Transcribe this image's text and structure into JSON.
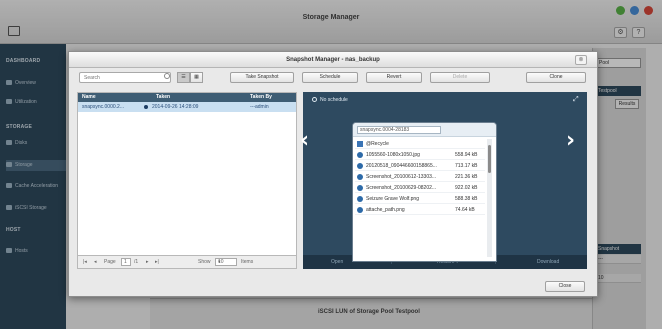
{
  "app": {
    "title": "Storage Manager"
  },
  "sidebar": {
    "sections": [
      {
        "label": "DASHBOARD"
      },
      {
        "label": "STORAGE"
      },
      {
        "label": "HOST"
      }
    ],
    "items": [
      {
        "label": "Overview",
        "icon": "overview-icon"
      },
      {
        "label": "Utilization",
        "icon": "chart-icon"
      },
      {
        "label": "Disks",
        "icon": "disk-icon"
      },
      {
        "label": "Storage",
        "icon": "storage-icon"
      },
      {
        "label": "Cache Acceleration",
        "icon": "cache-icon"
      },
      {
        "label": "iSCSI Storage",
        "icon": "iscsi-icon"
      },
      {
        "label": "Hosts",
        "icon": "hosts-icon"
      }
    ]
  },
  "background": {
    "bottom_text": "iSCSI LUN of Storage Pool Testpool"
  },
  "modal": {
    "title": "Snapshot Manager - nas_backup",
    "search_placeholder": "Search",
    "view_list": "☰",
    "view_grid": "▦",
    "buttons": {
      "take_snapshot": "Take Snapshot",
      "schedule": "Schedule",
      "revert": "Revert",
      "delete": "Delete",
      "clone": "Clone",
      "close": "Close"
    },
    "list": {
      "columns": [
        "Name",
        "Taken",
        "Taken By"
      ],
      "rows": [
        {
          "name": "snapsync.0000.2...",
          "taken": "2014-09-26 14:28:09",
          "taken_by": "---admin"
        }
      ]
    },
    "pager": {
      "page_label": "Page",
      "page_value": "1",
      "page_total": "/1",
      "show_label": "Show",
      "show_value": "10",
      "items_label": "Items"
    },
    "preview": {
      "no_schedule": "No schedule",
      "snapshot_name": "snapsync.0004-28183",
      "files": [
        {
          "name": "@Recycle",
          "size": "",
          "folder": true
        },
        {
          "name": "1055560-1080x1050.jpg",
          "size": "558.94 kB",
          "folder": false
        },
        {
          "name": "20120518_090446600158865...",
          "size": "713.17 kB",
          "folder": false
        },
        {
          "name": "Screenshot_20100612-13303...",
          "size": "221.36 kB",
          "folder": false
        },
        {
          "name": "Screenshot_20100629-08202...",
          "size": "922.02 kB",
          "folder": false
        },
        {
          "name": "Seizure Grave Wolf.png",
          "size": "588.38 kB",
          "folder": false
        },
        {
          "name": "attache_path.png",
          "size": "74.64 kB",
          "folder": false
        }
      ],
      "actions": {
        "open": "Open",
        "restore": "Restore ▾",
        "download": "Download"
      }
    }
  },
  "right_panel": {
    "select": "Pool",
    "label_a": "Testpool",
    "button": "Results",
    "label_b": "Snapshot",
    "row_a": "---",
    "row_b": "10"
  }
}
